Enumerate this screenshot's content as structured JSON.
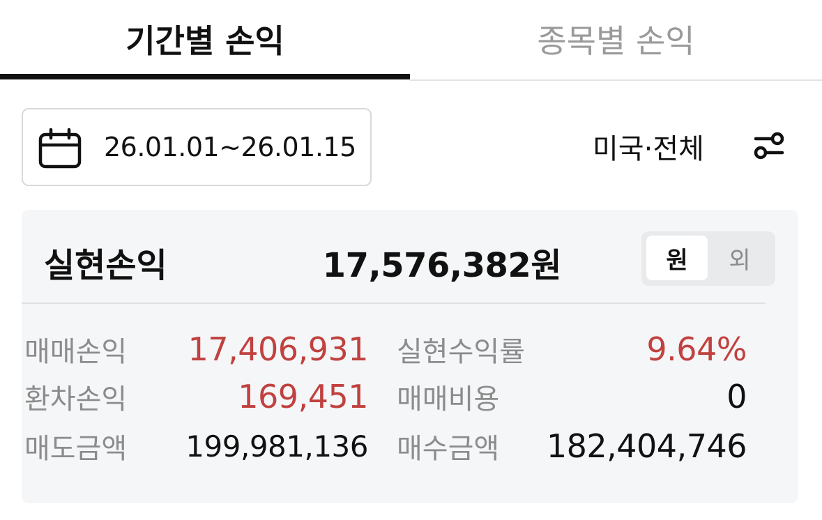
{
  "tabs": {
    "period": "기간별 손익",
    "stock": "종목별 손익"
  },
  "filters": {
    "date_range": "26.01.01~26.01.15",
    "market": "미국·전체"
  },
  "summary": {
    "title": "실현손익",
    "total": "17,576,382원",
    "currency_toggle": {
      "krw": "원",
      "foreign": "외",
      "selected": "원"
    }
  },
  "stats": {
    "trade_profit_label": "매매손익",
    "trade_profit_value": "17,406,931",
    "fx_profit_label": "환차손익",
    "fx_profit_value": "169,451",
    "sell_amount_label": "매도금액",
    "sell_amount_value": "199,981,136",
    "return_rate_label": "실현수익률",
    "return_rate_value": "9.64%",
    "trade_cost_label": "매매비용",
    "trade_cost_value": "0",
    "buy_amount_label": "매수금액",
    "buy_amount_value": "182,404,746"
  },
  "colors": {
    "profit_red": "#c0413f",
    "muted_label": "#8c8c8c",
    "panel_bg": "#f5f6f8"
  },
  "icons": {
    "calendar": "calendar-icon",
    "filter": "filter-sliders-icon"
  }
}
